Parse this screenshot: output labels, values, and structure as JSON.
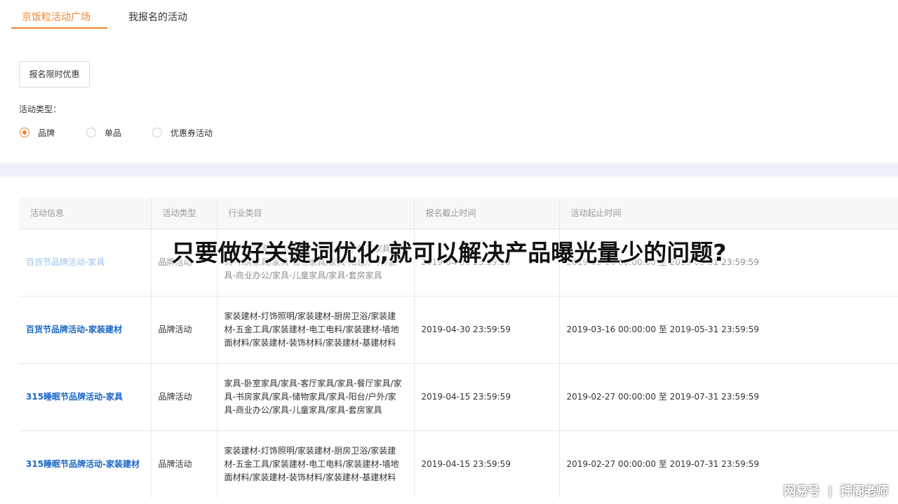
{
  "tabs": [
    {
      "label": "京饭粒活动广场",
      "active": true
    },
    {
      "label": "我报名的活动",
      "active": false
    }
  ],
  "filter": {
    "button_label": "报名限时优惠",
    "type_label": "活动类型：",
    "options": [
      {
        "label": "品牌",
        "checked": true
      },
      {
        "label": "单品",
        "checked": false
      },
      {
        "label": "优惠券活动",
        "checked": false
      }
    ]
  },
  "table": {
    "headers": [
      "活动信息",
      "活动类型",
      "行业类目",
      "报名截止时间",
      "活动起止时间"
    ],
    "rows": [
      {
        "name": "百货节品牌活动-家具",
        "type": "品牌活动",
        "category": "家具-卧室家具/家具-客厅家具/家具-餐厅家具/家具-书房家具/家具-储物家具/家具-阳台/户外/家具-商业办公/家具-儿童家具/家具-套房家具",
        "deadline": "2019-04-30 23:59:59",
        "period": "2019-03-16 00:00:00 至 2019-05-31 23:59:59"
      },
      {
        "name": "百货节品牌活动-家装建材",
        "type": "品牌活动",
        "category": "家装建材-灯饰照明/家装建材-厨房卫浴/家装建材-五金工具/家装建材-电工电料/家装建材-墙地面材料/家装建材-装饰材料/家装建材-基建材料",
        "deadline": "2019-04-30 23:59:59",
        "period": "2019-03-16 00:00:00 至 2019-05-31 23:59:59"
      },
      {
        "name": "315睡眠节品牌活动-家具",
        "type": "品牌活动",
        "category": "家具-卧室家具/家具-客厅家具/家具-餐厅家具/家具-书房家具/家具-储物家具/家具-阳台/户外/家具-商业办公/家具-儿童家具/家具-套房家具",
        "deadline": "2019-04-15 23:59:59",
        "period": "2019-02-27 00:00:00 至 2019-07-31 23:59:59"
      },
      {
        "name": "315睡眠节品牌活动-家装建材",
        "type": "品牌活动",
        "category": "家装建材-灯饰照明/家装建材-厨房卫浴/家装建材-五金工具/家装建材-电工电料/家装建材-墙地面材料/家装建材-装饰材料/家装建材-基建材料",
        "deadline": "2019-04-15 23:59:59",
        "period": "2019-02-27 00:00:00 至 2019-07-31 23:59:59"
      }
    ]
  },
  "overlay": {
    "title": "只要做好关键词优化,就可以解决产品曝光量少的问题?"
  },
  "watermark": {
    "left": "网易号",
    "separator": "|",
    "right": "押阁老师"
  },
  "colors": {
    "accent": "#f0862f",
    "link": "#1a66c6"
  }
}
